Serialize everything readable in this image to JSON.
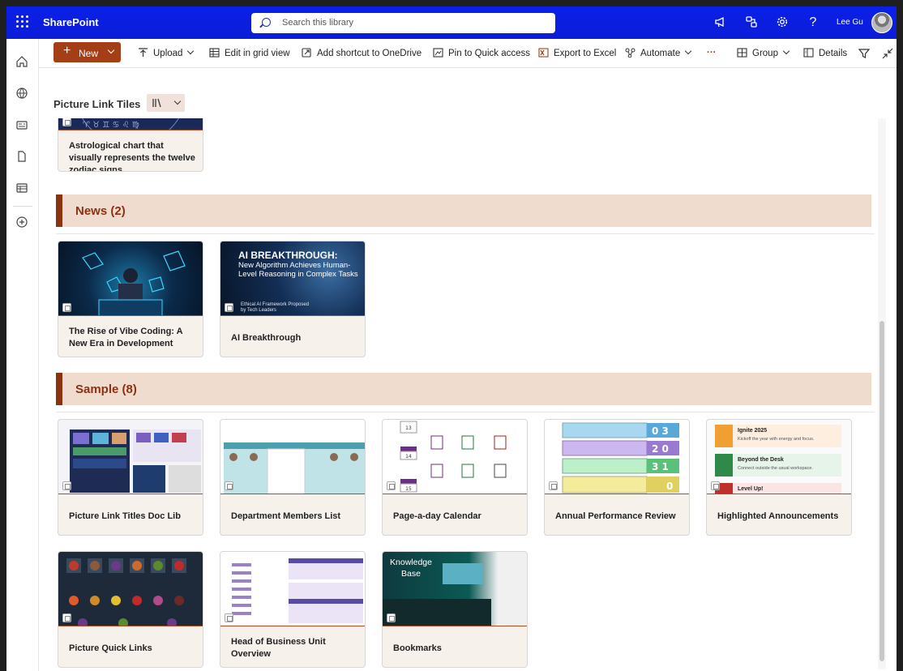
{
  "topbar": {
    "app_name": "SharePoint",
    "search_placeholder": "Search this library",
    "user_name": "Lee Gu"
  },
  "command_bar": {
    "new": "New",
    "upload": "Upload",
    "edit_grid": "Edit in grid view",
    "add_shortcut": "Add shortcut to OneDrive",
    "pin": "Pin to Quick access",
    "export": "Export to Excel",
    "automate": "Automate",
    "more": "···",
    "group": "Group",
    "details": "Details"
  },
  "view": {
    "title": "Picture Link Tiles"
  },
  "groups": [
    {
      "label": "News (2)"
    },
    {
      "label": "Sample (8)"
    }
  ],
  "partial_tile": {
    "title": "Astrological chart that visually represents the twelve zodiac signs"
  },
  "news_tiles": [
    {
      "title": "The Rise of Vibe Coding: A New Era in Development"
    },
    {
      "title": "AI Breakthrough",
      "img_headline": "AI BREAKTHROUGH:",
      "img_sub": "New Algorithm Achieves Human-Level Reasoning in Complex Tasks",
      "img_foot": "Ethical AI Framework Proposed by Tech Leaders"
    }
  ],
  "sample_tiles": [
    {
      "title": "Picture Link Titles Doc Lib"
    },
    {
      "title": "Department Members List"
    },
    {
      "title": "Page-a-day Calendar"
    },
    {
      "title": "Annual Performance Review"
    },
    {
      "title": "Highlighted Announcements",
      "items": [
        "Ignite 2025",
        "Kickoff the year with energy and focus.",
        "Beyond the Desk",
        "Connect outside the usual workspace.",
        "Level Up!"
      ]
    },
    {
      "title": "Picture Quick Links"
    },
    {
      "title": "Head of Business Unit Overview"
    },
    {
      "title": "Bookmarks",
      "img_text": "Knowledge Base"
    }
  ],
  "colors": {
    "suite_bar": "#0b20e8",
    "accent": "#a43e17",
    "group_bg": "#f0dccf",
    "group_text": "#8a3211"
  }
}
